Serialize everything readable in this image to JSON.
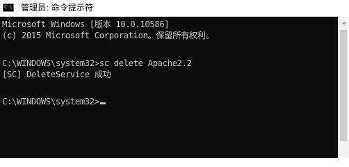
{
  "window": {
    "title": "管理员: 命令提示符",
    "icon_text": "C:\\",
    "icon": "console-app-icon",
    "colors": {
      "console_background": "#0c0c0c",
      "console_text": "#c0c0c0",
      "titlebar_background": "#ffffff"
    }
  },
  "console": {
    "lines": [
      "Microsoft Windows [版本 10.0.10586]",
      "(c) 2015 Microsoft Corporation。保留所有权利。",
      "",
      "C:\\WINDOWS\\system32>sc delete Apache2.2",
      "[SC] DeleteService 成功",
      "",
      "C:\\WINDOWS\\system32>"
    ]
  },
  "scrollbar": {
    "up_icon": "scroll-up-arrow-icon"
  }
}
